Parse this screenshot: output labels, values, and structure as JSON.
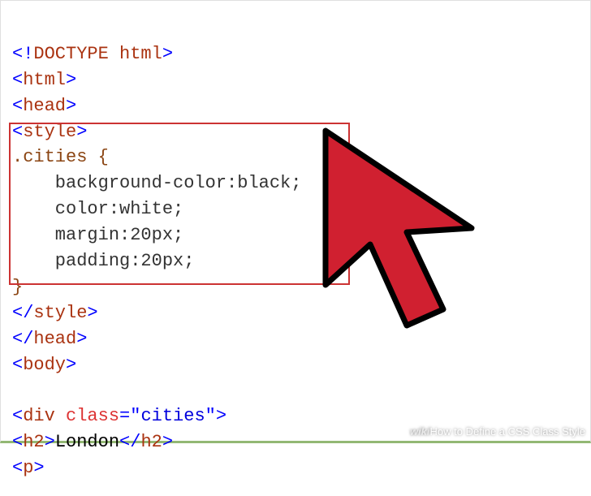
{
  "code": {
    "l1_open": "<!",
    "l1_doctype": "DOCTYPE",
    "l1_html": " html",
    "l1_close": ">",
    "l2_open": "<",
    "l2_tag": "html",
    "l2_close": ">",
    "l3_open": "<",
    "l3_tag": "head",
    "l3_close": ">",
    "l4_open": "<",
    "l4_tag": "style",
    "l4_close": ">",
    "l5": ".cities {",
    "l6": "    background-color:black;",
    "l7": "    color:white;",
    "l8": "    margin:20px;",
    "l9": "    padding:20px;",
    "l10": "}",
    "l11_open": "</",
    "l11_tag": "style",
    "l11_close": ">",
    "l12_open": "</",
    "l12_tag": "head",
    "l12_close": ">",
    "l13_open": "<",
    "l13_tag": "body",
    "l13_close": ">",
    "l14_open": "<",
    "l14_tag": "div",
    "l14_sp": " ",
    "l14_attr": "class",
    "l14_eq": "=\"",
    "l14_val": "cities",
    "l14_q": "\"",
    "l14_close": ">",
    "l15_open": "<",
    "l15_tag": "h2",
    "l15_close": ">",
    "l15_text": "London",
    "l15_open2": "</",
    "l15_tag2": "h2",
    "l15_close2": ">",
    "l16_open": "<",
    "l16_tag": "p",
    "l16_close": ">"
  },
  "watermark": {
    "wiki": "wiki",
    "title": "How to Define a CSS Class Style"
  }
}
